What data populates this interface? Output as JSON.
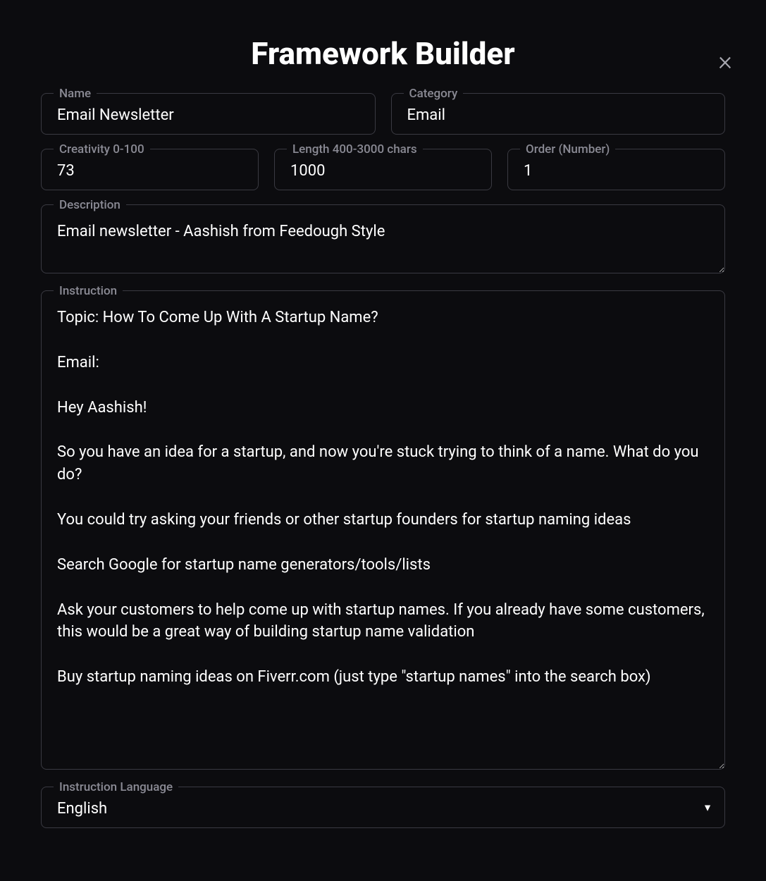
{
  "title": "Framework Builder",
  "close_label": "×",
  "fields": {
    "name": {
      "label": "Name",
      "value": "Email Newsletter"
    },
    "category": {
      "label": "Category",
      "value": "Email"
    },
    "creativity": {
      "label": "Creativity 0-100",
      "value": "73"
    },
    "length": {
      "label": "Length 400-3000 chars",
      "value": "1000"
    },
    "order": {
      "label": "Order (Number)",
      "value": "1"
    },
    "description": {
      "label": "Description",
      "value": "Email newsletter - Aashish from Feedough Style"
    },
    "instruction": {
      "label": "Instruction",
      "value": "Topic: How To Come Up With A Startup Name?\n\nEmail:\n\nHey Aashish!\n\nSo you have an idea for a startup, and now you're stuck trying to think of a name. What do you do?\n\nYou could try asking your friends or other startup founders for startup naming ideas\n\nSearch Google for startup name generators/tools/lists\n\nAsk your customers to help come up with startup names. If you already have some customers, this would be a great way of building startup name validation\n\nBuy startup naming ideas on Fiverr.com (just type \"startup names\" into the search box)"
    },
    "instruction_language": {
      "label": "Instruction Language",
      "value": "English"
    }
  }
}
